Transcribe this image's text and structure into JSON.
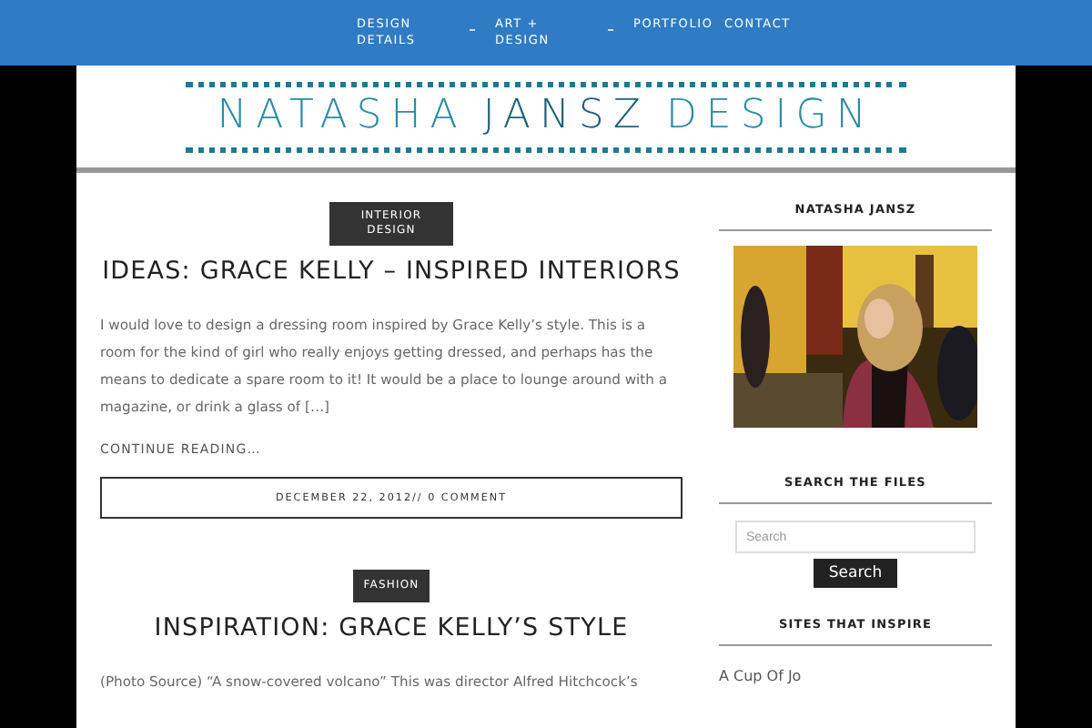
{
  "nav": {
    "items": [
      {
        "label": "DESIGN DETAILS",
        "has_submenu": true
      },
      {
        "label": "ART + DESIGN",
        "has_submenu": true
      },
      {
        "label": "PORTFOLIO",
        "has_submenu": false
      },
      {
        "label": "CONTACT",
        "has_submenu": false
      }
    ]
  },
  "logo": {
    "first": "NATASHA",
    "middle": "JANSZ",
    "last": "DESIGN"
  },
  "posts": [
    {
      "category": "INTERIOR DESIGN",
      "title": "IDEAS: GRACE KELLY – INSPIRED INTERIORS",
      "excerpt": "I would love to design a dressing room inspired by Grace Kelly’s style. This is a room for the kind of girl who really enjoys getting dressed, and perhaps has the means to dedicate a spare room to it!   It would be a place to lounge around with a magazine, or drink a glass of […]",
      "more": "CONTINUE READING…",
      "meta": "DECEMBER 22, 2012// 0 COMMENT"
    },
    {
      "category": "FASHION",
      "title": "INSPIRATION: GRACE KELLY’S STYLE",
      "excerpt": "(Photo Source)  “A snow-covered volcano”   This was director Alfred Hitchcock’s"
    }
  ],
  "sidebar": {
    "about_title": "NATASHA JANSZ",
    "photo": {
      "kind": "picture"
    },
    "search_title": "SEARCH THE FILES",
    "search_placeholder": "Search",
    "search_button": "Search",
    "links_title": "SITES THAT INSPIRE",
    "links": [
      "A Cup Of Jo"
    ]
  }
}
